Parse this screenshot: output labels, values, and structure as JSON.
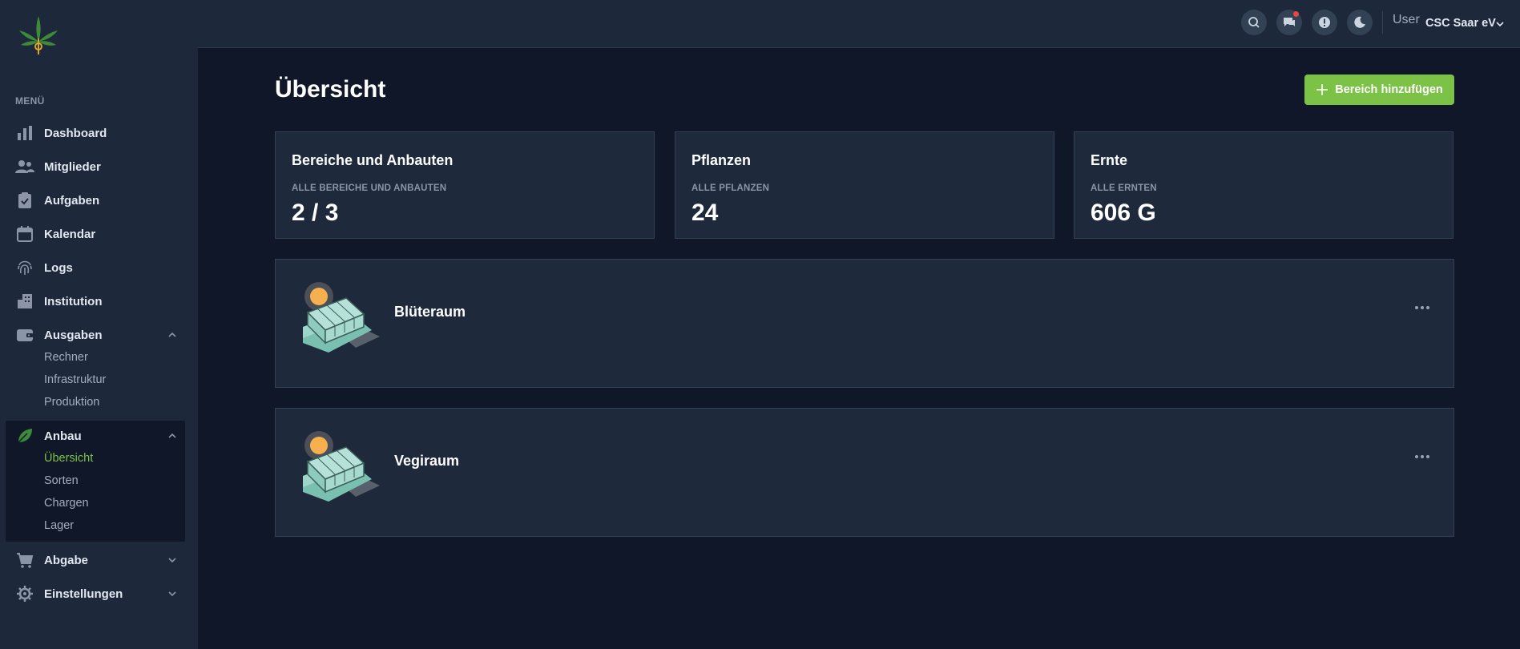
{
  "sidebar": {
    "menu_heading": "MENÜ",
    "items": [
      {
        "label": "Dashboard",
        "icon": "chart-bars-icon"
      },
      {
        "label": "Mitglieder",
        "icon": "users-icon"
      },
      {
        "label": "Aufgaben",
        "icon": "clipboard-check-icon"
      },
      {
        "label": "Kalendar",
        "icon": "calendar-icon"
      },
      {
        "label": "Logs",
        "icon": "fingerprint-icon"
      },
      {
        "label": "Institution",
        "icon": "building-icon"
      },
      {
        "label": "Ausgaben",
        "icon": "wallet-icon"
      },
      {
        "label": "Anbau",
        "icon": "leaf-icon"
      },
      {
        "label": "Abgabe",
        "icon": "cart-icon"
      },
      {
        "label": "Einstellungen",
        "icon": "gear-icon"
      }
    ],
    "ausgaben_sub": [
      "Rechner",
      "Infrastruktur",
      "Produktion"
    ],
    "anbau_sub": [
      "Übersicht",
      "Sorten",
      "Chargen",
      "Lager"
    ],
    "active_sub": "Übersicht"
  },
  "header": {
    "user_label": "User",
    "user_name": "CSC Saar eV",
    "icons": [
      "search-icon",
      "chat-icon",
      "alert-icon",
      "moon-icon"
    ],
    "notification_dot_color": "#ef4444"
  },
  "main": {
    "title": "Übersicht",
    "add_button": "Bereich hinzufügen",
    "stats": [
      {
        "title": "Bereiche und Anbauten",
        "subtitle": "ALLE BEREICHE UND ANBAUTEN",
        "value": "2 / 3"
      },
      {
        "title": "Pflanzen",
        "subtitle": "ALLE PFLANZEN",
        "value": "24"
      },
      {
        "title": "Ernte",
        "subtitle": "ALLE ERNTEN",
        "value": "606 G"
      }
    ],
    "rooms": [
      {
        "name": "Blüteraum"
      },
      {
        "name": "Vegiraum"
      }
    ]
  },
  "colors": {
    "accent": "#7cc246",
    "sidebar_bg": "#1d283a",
    "page_bg": "#0f1729",
    "card_bg": "#1e293b"
  }
}
